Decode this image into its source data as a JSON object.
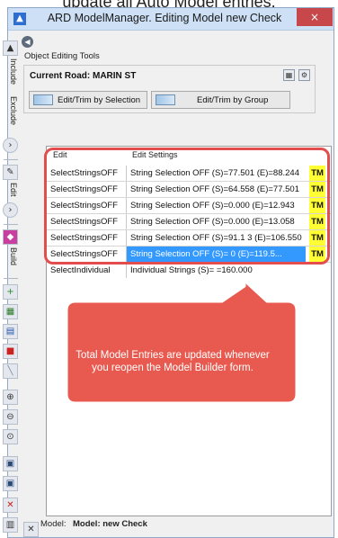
{
  "caption": "update all Auto Model entries.",
  "window": {
    "title": "ARD ModelManager. Editing Model  new Check",
    "close_glyph": "×"
  },
  "sidebar": {
    "labels": [
      "Include",
      "Exclude",
      "Edit",
      "Build"
    ],
    "icons": [
      "navigate-up-icon",
      "include-icon",
      "exclude-icon",
      "collapse-icon",
      "edit-icon",
      "edit-expand-icon",
      "build-icon",
      "add-icon",
      "model-icon",
      "grid-icon",
      "color-icon",
      "line-icon",
      "zoom-in-icon",
      "zoom-out-icon",
      "zoom-extents-icon",
      "save-icon",
      "save-as-icon",
      "delete-icon",
      "report-icon",
      "close-model-icon"
    ]
  },
  "header": {
    "section_label": "Object Editing Tools",
    "road_label": "Current Road: MARIN ST",
    "buttons": {
      "edit_trim_selection": "Edit/Trim by Selection",
      "edit_trim_group": "Edit/Trim by Group"
    }
  },
  "grid": {
    "columns": [
      "Edit",
      "Edit Settings",
      ""
    ],
    "rows": [
      {
        "edit": "SelectStringsOFF",
        "settings": "String Selection OFF (S)=77.501  (E)=88.244",
        "tag": "TM"
      },
      {
        "edit": "SelectStringsOFF",
        "settings": "String Selection OFF (S)=64.558  (E)=77.501",
        "tag": "TM"
      },
      {
        "edit": "SelectStringsOFF",
        "settings": "String Selection OFF (S)=0.000  (E)=12.943",
        "tag": "TM"
      },
      {
        "edit": "SelectStringsOFF",
        "settings": "String Selection OFF (S)=0.000  (E)=13.058",
        "tag": "TM"
      },
      {
        "edit": "SelectStringsOFF",
        "settings": "String Selection OFF (S)=91.1  3  (E)=106.550",
        "tag": "TM"
      },
      {
        "edit": "SelectStringsOFF",
        "settings": "String Selection OFF (S)=        0  (E)=119.5...",
        "tag": "TM"
      },
      {
        "edit": "SelectIndividual",
        "settings": "Individual Strings (S)=              =160.000",
        "tag": ""
      }
    ]
  },
  "callout": {
    "text": "Total Model Entries are updated whenever you reopen the Model Builder form."
  },
  "status": {
    "label": "Model:",
    "value": "Model: new Check"
  },
  "colors": {
    "highlight_border": "#e34d4d",
    "callout_fill": "#e85a4f",
    "tm_fill": "#ffff33",
    "selection": "#3399ff"
  }
}
